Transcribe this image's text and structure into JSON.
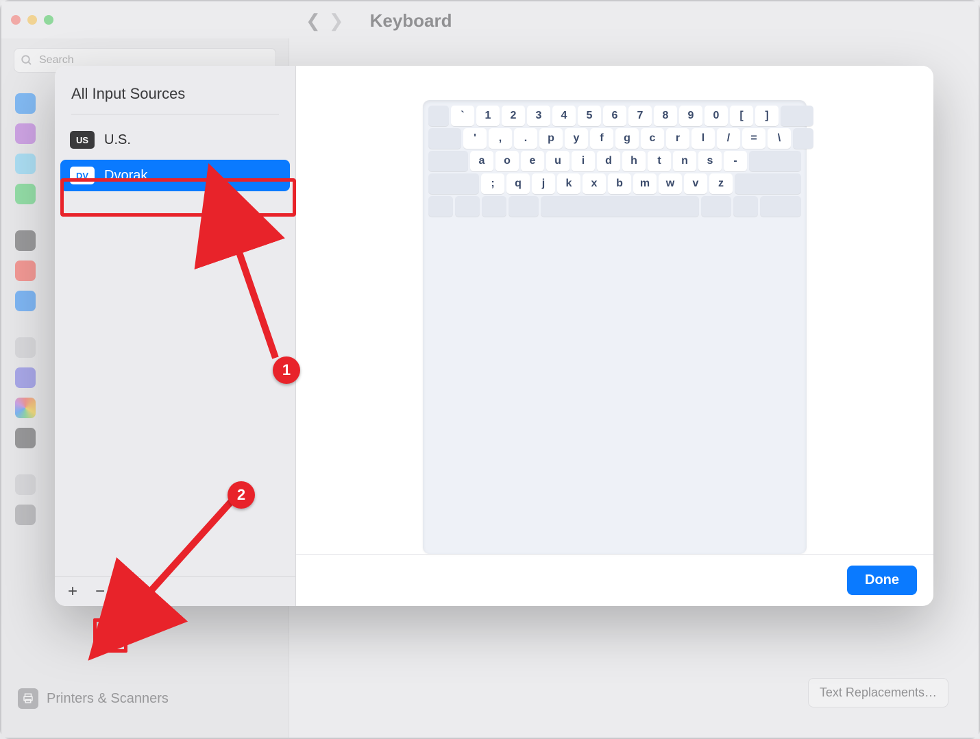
{
  "window": {
    "title": "Keyboard",
    "search_placeholder": "Search"
  },
  "background": {
    "sidebar_bottom_label": "Printers & Scanners",
    "text_replacements_button": "Text Replacements…"
  },
  "sheet": {
    "header": "All Input Sources",
    "sources": [
      {
        "badge": "US",
        "label": "U.S.",
        "selected": false
      },
      {
        "badge": "DV",
        "label": "Dvorak",
        "selected": true
      }
    ],
    "add_button": "+",
    "remove_button": "−",
    "done_button": "Done",
    "keyboard": {
      "row1": [
        "`",
        "1",
        "2",
        "3",
        "4",
        "5",
        "6",
        "7",
        "8",
        "9",
        "0",
        "[",
        "]"
      ],
      "row2": [
        "'",
        ",",
        ".",
        "p",
        "y",
        "f",
        "g",
        "c",
        "r",
        "l",
        "/",
        "=",
        "\\"
      ],
      "row3": [
        "a",
        "o",
        "e",
        "u",
        "i",
        "d",
        "h",
        "t",
        "n",
        "s",
        "-"
      ],
      "row4": [
        ";",
        "q",
        "j",
        "k",
        "x",
        "b",
        "m",
        "w",
        "v",
        "z"
      ]
    }
  },
  "annotations": {
    "step1": "1",
    "step2": "2"
  }
}
